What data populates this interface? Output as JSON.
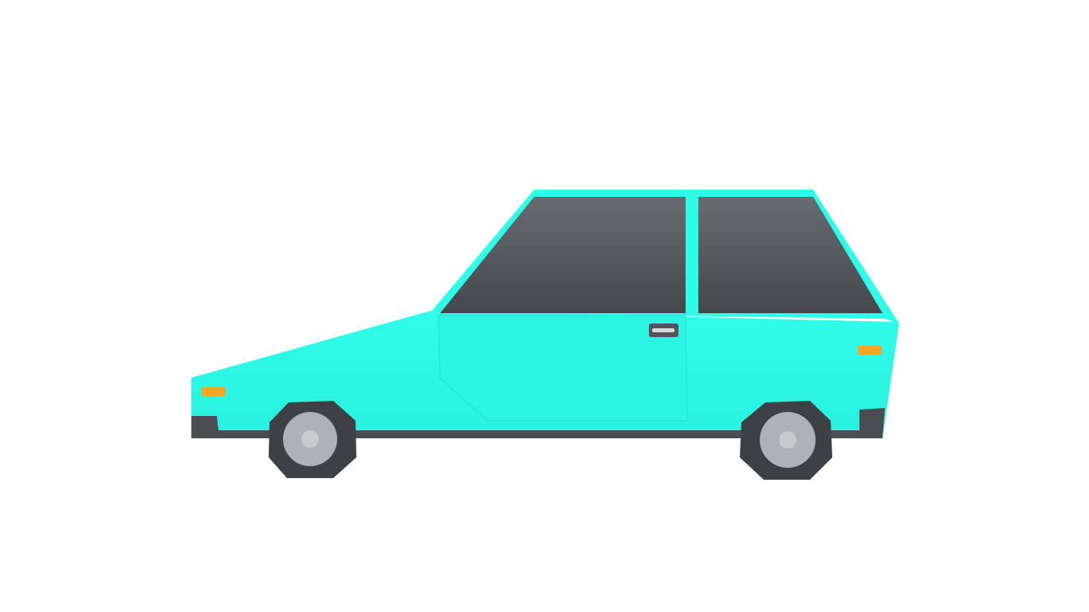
{
  "scene": {
    "background_color": "#ffffff",
    "subject": "car-side-view"
  },
  "colors": {
    "body": "#2efde9",
    "body_shade": "#27f2de",
    "window": "#4f5357",
    "window_light": "#666a6e",
    "bumper": "#4a4d52",
    "tire": "#3d4045",
    "tire_edge": "#2f3236",
    "rim": "#aeb1b5",
    "rim_hub": "#c8cbce",
    "light": "#f5a623",
    "handle": "#52565b"
  },
  "icons": [
    "car-icon",
    "wheel-icon",
    "headlight-icon",
    "taillight-icon",
    "door-handle-icon"
  ]
}
